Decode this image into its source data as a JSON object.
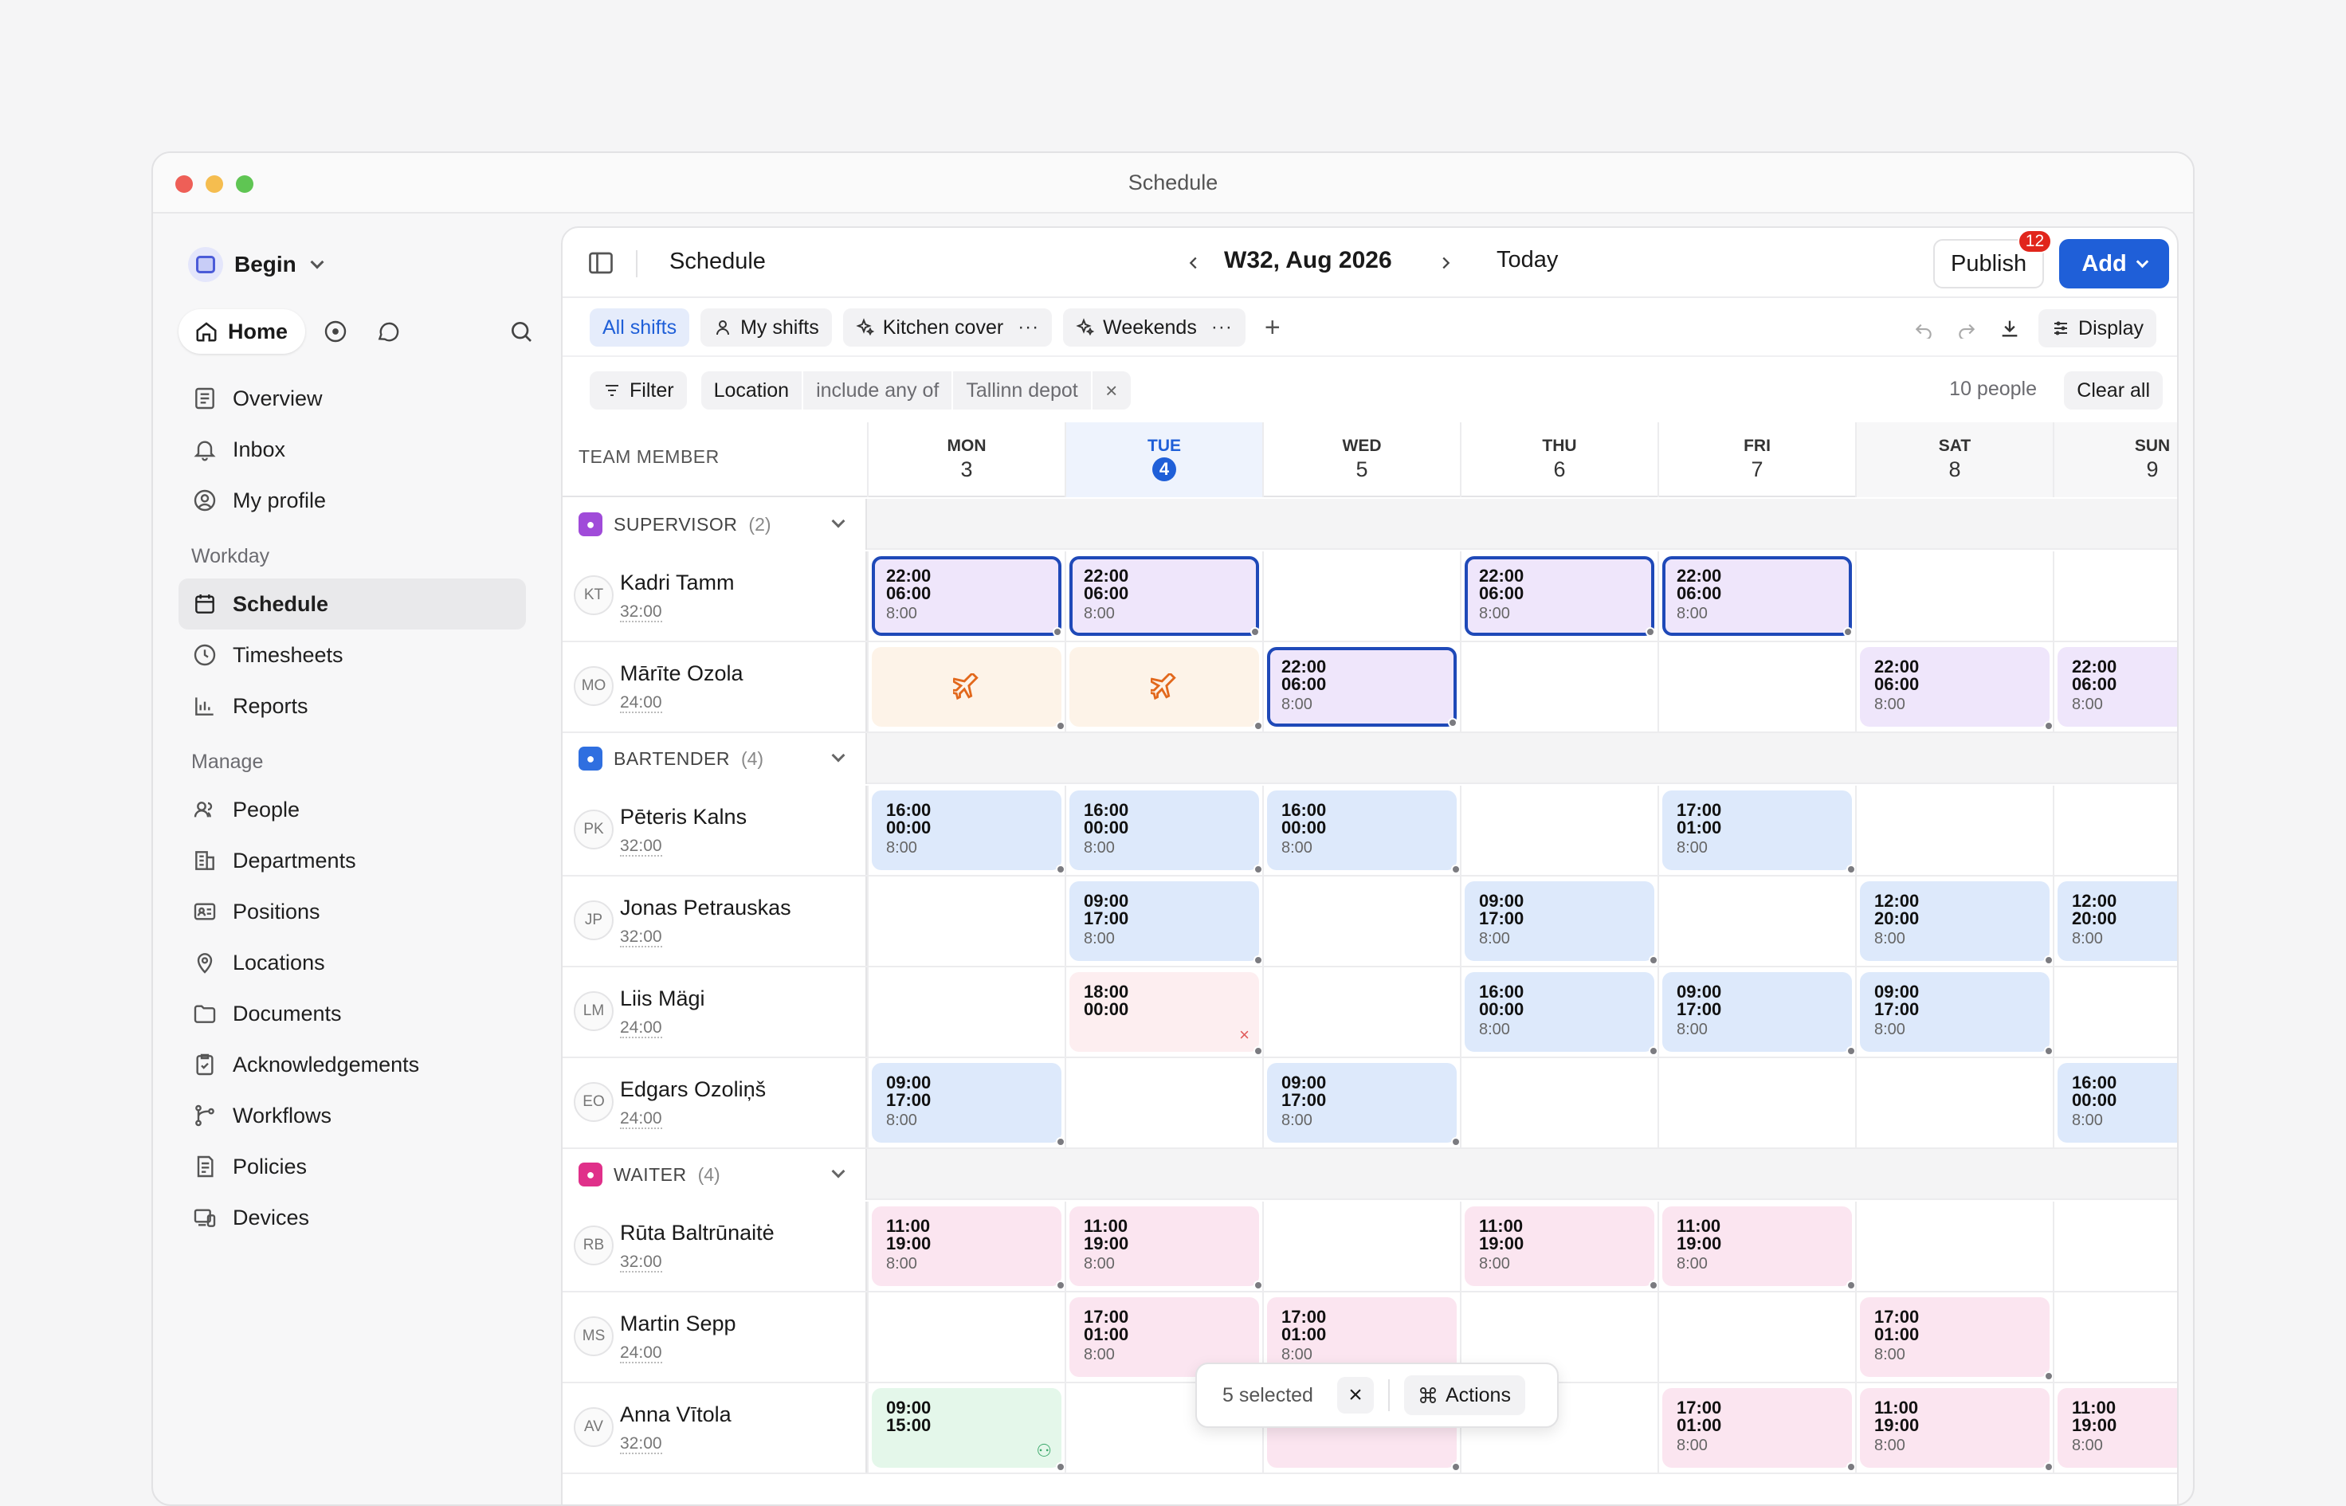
{
  "window": {
    "title": "Schedule"
  },
  "sidebar": {
    "workspace": "Begin",
    "home_label": "Home",
    "main_items": [
      {
        "label": "Overview",
        "icon": "overview-icon"
      },
      {
        "label": "Inbox",
        "icon": "bell-icon"
      },
      {
        "label": "My profile",
        "icon": "profile-icon"
      }
    ],
    "workday_heading": "Workday",
    "workday_items": [
      {
        "label": "Schedule",
        "icon": "calendar-icon",
        "active": true
      },
      {
        "label": "Timesheets",
        "icon": "clock-icon"
      },
      {
        "label": "Reports",
        "icon": "bar-chart-icon"
      }
    ],
    "manage_heading": "Manage",
    "manage_items": [
      {
        "label": "People",
        "icon": "people-icon"
      },
      {
        "label": "Departments",
        "icon": "building-icon"
      },
      {
        "label": "Positions",
        "icon": "id-card-icon"
      },
      {
        "label": "Locations",
        "icon": "map-pin-icon"
      },
      {
        "label": "Documents",
        "icon": "folder-icon"
      },
      {
        "label": "Acknowledgements",
        "icon": "clipboard-check-icon"
      },
      {
        "label": "Workflows",
        "icon": "workflow-icon"
      },
      {
        "label": "Policies",
        "icon": "policy-icon"
      },
      {
        "label": "Devices",
        "icon": "devices-icon"
      }
    ]
  },
  "header": {
    "title": "Schedule",
    "week_label": "W32, Aug 2026",
    "today_label": "Today",
    "publish_label": "Publish",
    "publish_badge": "12",
    "add_label": "Add"
  },
  "tabs": [
    {
      "label": "All shifts",
      "active": true
    },
    {
      "label": "My shifts",
      "icon": "person-icon"
    },
    {
      "label": "Kitchen cover",
      "icon": "sparkle-icon",
      "menu": "···"
    },
    {
      "label": "Weekends",
      "icon": "sparkle-icon",
      "menu": "···"
    }
  ],
  "toolbar": {
    "display_label": "Display"
  },
  "filters": {
    "filter_label": "Filter",
    "field": "Location",
    "operator": "include any of",
    "value": "Tallinn depot",
    "remove": "×",
    "people_count": "10 people",
    "clear_all_label": "Clear all"
  },
  "grid": {
    "member_header": "TEAM MEMBER",
    "days": [
      {
        "name": "MON",
        "num": "3"
      },
      {
        "name": "TUE",
        "num": "4",
        "today": true
      },
      {
        "name": "WED",
        "num": "5"
      },
      {
        "name": "THU",
        "num": "6"
      },
      {
        "name": "FRI",
        "num": "7"
      },
      {
        "name": "SAT",
        "num": "8",
        "weekend": true
      },
      {
        "name": "SUN",
        "num": "9",
        "weekend": true
      }
    ],
    "groups": [
      {
        "name": "SUPERVISOR",
        "count": "(2)",
        "color": "#a04bd9",
        "members": [
          {
            "initials": "KT",
            "name": "Kadri Tamm",
            "hours": "32:00",
            "shifts": [
              {
                "day": 0,
                "start": "22:00",
                "end": "06:00",
                "dur": "8:00",
                "color": "purple",
                "selected": true
              },
              {
                "day": 1,
                "start": "22:00",
                "end": "06:00",
                "dur": "8:00",
                "color": "purple",
                "selected": true
              },
              {
                "day": 3,
                "start": "22:00",
                "end": "06:00",
                "dur": "8:00",
                "color": "purple",
                "selected": true
              },
              {
                "day": 4,
                "start": "22:00",
                "end": "06:00",
                "dur": "8:00",
                "color": "purple",
                "selected": true
              }
            ]
          },
          {
            "initials": "MO",
            "name": "Mārīte Ozola",
            "hours": "24:00",
            "shifts": [
              {
                "day": 0,
                "type": "leave",
                "color": "orange"
              },
              {
                "day": 1,
                "type": "leave",
                "color": "orange"
              },
              {
                "day": 2,
                "start": "22:00",
                "end": "06:00",
                "dur": "8:00",
                "color": "purple",
                "selected": true
              },
              {
                "day": 5,
                "start": "22:00",
                "end": "06:00",
                "dur": "8:00",
                "color": "purple"
              },
              {
                "day": 6,
                "start": "22:00",
                "end": "06:00",
                "dur": "8:00",
                "color": "purple"
              }
            ]
          }
        ]
      },
      {
        "name": "BARTENDER",
        "count": "(4)",
        "color": "#2f6fe0",
        "members": [
          {
            "initials": "PK",
            "name": "Pēteris Kalns",
            "hours": "32:00",
            "shifts": [
              {
                "day": 0,
                "start": "16:00",
                "end": "00:00",
                "dur": "8:00",
                "color": "blue"
              },
              {
                "day": 1,
                "start": "16:00",
                "end": "00:00",
                "dur": "8:00",
                "color": "blue"
              },
              {
                "day": 2,
                "start": "16:00",
                "end": "00:00",
                "dur": "8:00",
                "color": "blue"
              },
              {
                "day": 4,
                "start": "17:00",
                "end": "01:00",
                "dur": "8:00",
                "color": "blue"
              }
            ]
          },
          {
            "initials": "JP",
            "name": "Jonas Petrauskas",
            "hours": "32:00",
            "shifts": [
              {
                "day": 1,
                "start": "09:00",
                "end": "17:00",
                "dur": "8:00",
                "color": "blue"
              },
              {
                "day": 3,
                "start": "09:00",
                "end": "17:00",
                "dur": "8:00",
                "color": "blue"
              },
              {
                "day": 5,
                "start": "12:00",
                "end": "20:00",
                "dur": "8:00",
                "color": "blue"
              },
              {
                "day": 6,
                "start": "12:00",
                "end": "20:00",
                "dur": "8:00",
                "color": "blue"
              }
            ]
          },
          {
            "initials": "LM",
            "name": "Liis Mägi",
            "hours": "24:00",
            "shifts": [
              {
                "day": 1,
                "start": "18:00",
                "end": "00:00",
                "dur": "",
                "color": "red",
                "mark": "×"
              },
              {
                "day": 3,
                "start": "16:00",
                "end": "00:00",
                "dur": "8:00",
                "color": "blue"
              },
              {
                "day": 4,
                "start": "09:00",
                "end": "17:00",
                "dur": "8:00",
                "color": "blue"
              },
              {
                "day": 5,
                "start": "09:00",
                "end": "17:00",
                "dur": "8:00",
                "color": "blue"
              }
            ]
          },
          {
            "initials": "EO",
            "name": "Edgars Ozoliņš",
            "hours": "24:00",
            "shifts": [
              {
                "day": 0,
                "start": "09:00",
                "end": "17:00",
                "dur": "8:00",
                "color": "blue"
              },
              {
                "day": 2,
                "start": "09:00",
                "end": "17:00",
                "dur": "8:00",
                "color": "blue"
              },
              {
                "day": 6,
                "start": "16:00",
                "end": "00:00",
                "dur": "8:00",
                "color": "blue"
              }
            ]
          }
        ]
      },
      {
        "name": "WAITER",
        "count": "(4)",
        "color": "#e0308a",
        "members": [
          {
            "initials": "RB",
            "name": "Rūta Baltrūnaitė",
            "hours": "32:00",
            "shifts": [
              {
                "day": 0,
                "start": "11:00",
                "end": "19:00",
                "dur": "8:00",
                "color": "pink"
              },
              {
                "day": 1,
                "start": "11:00",
                "end": "19:00",
                "dur": "8:00",
                "color": "pink"
              },
              {
                "day": 3,
                "start": "11:00",
                "end": "19:00",
                "dur": "8:00",
                "color": "pink"
              },
              {
                "day": 4,
                "start": "11:00",
                "end": "19:00",
                "dur": "8:00",
                "color": "pink"
              }
            ]
          },
          {
            "initials": "MS",
            "name": "Martin Sepp",
            "hours": "24:00",
            "shifts": [
              {
                "day": 1,
                "start": "17:00",
                "end": "01:00",
                "dur": "8:00",
                "color": "pink"
              },
              {
                "day": 2,
                "start": "17:00",
                "end": "01:00",
                "dur": "8:00",
                "color": "pink"
              },
              {
                "day": 5,
                "start": "17:00",
                "end": "01:00",
                "dur": "8:00",
                "color": "pink"
              }
            ]
          },
          {
            "initials": "AV",
            "name": "Anna Vītola",
            "hours": "32:00",
            "shifts": [
              {
                "day": 0,
                "start": "09:00",
                "end": "15:00",
                "dur": "",
                "color": "green",
                "mark": "⚇"
              },
              {
                "day": 2,
                "start": "",
                "end": "",
                "dur": "8:00",
                "color": "pink"
              },
              {
                "day": 4,
                "start": "17:00",
                "end": "01:00",
                "dur": "8:00",
                "color": "pink"
              },
              {
                "day": 5,
                "start": "11:00",
                "end": "19:00",
                "dur": "8:00",
                "color": "pink"
              },
              {
                "day": 6,
                "start": "11:00",
                "end": "19:00",
                "dur": "8:00",
                "color": "pink"
              }
            ]
          }
        ]
      }
    ]
  },
  "selection": {
    "count_label": "5 selected",
    "close": "×",
    "actions_label": "Actions"
  },
  "colors": {
    "accent": "#1f5fd8",
    "selected_border": "#1f49b8",
    "badge": "#e1261c"
  }
}
